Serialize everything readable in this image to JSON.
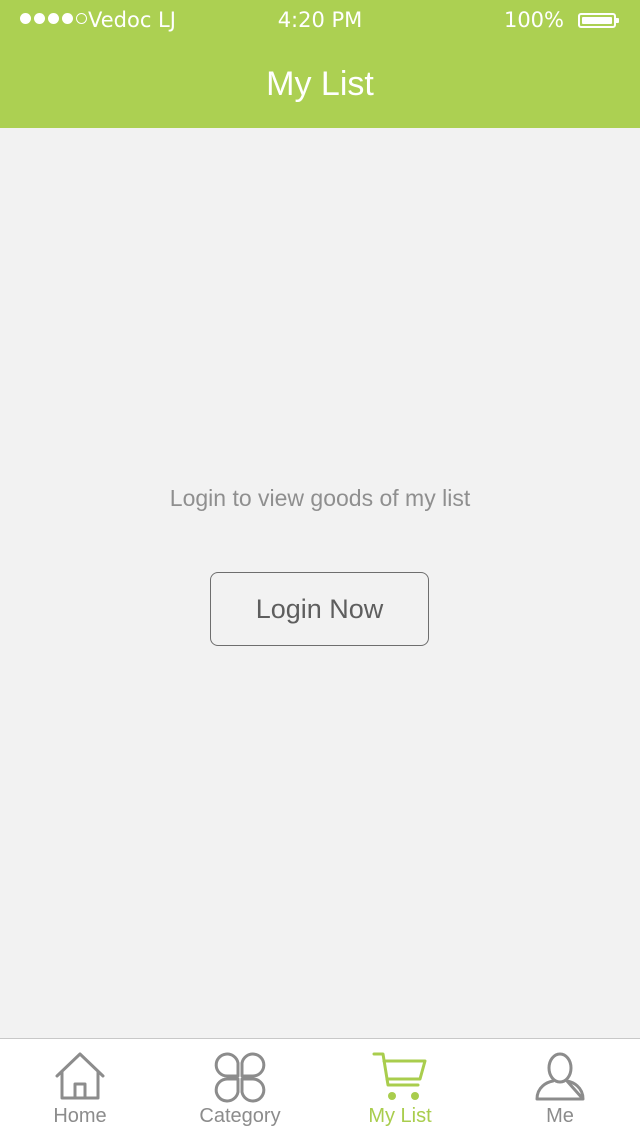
{
  "status_bar": {
    "carrier": "Vedoc LJ",
    "time": "4:20 PM",
    "battery_percent": "100%",
    "signal_bars_filled": 4,
    "signal_bars_total": 5
  },
  "header": {
    "title": "My List",
    "background_color": "#acd052"
  },
  "main": {
    "prompt": "Login to view goods of my list",
    "login_button_label": "Login Now"
  },
  "tab_bar": {
    "active_color": "#a9cd4d",
    "inactive_color": "#8c8c8c",
    "tabs": [
      {
        "label": "Home",
        "icon": "home-icon",
        "active": false
      },
      {
        "label": "Category",
        "icon": "category-icon",
        "active": false
      },
      {
        "label": "My List",
        "icon": "cart-icon",
        "active": true
      },
      {
        "label": "Me",
        "icon": "person-icon",
        "active": false
      }
    ]
  }
}
